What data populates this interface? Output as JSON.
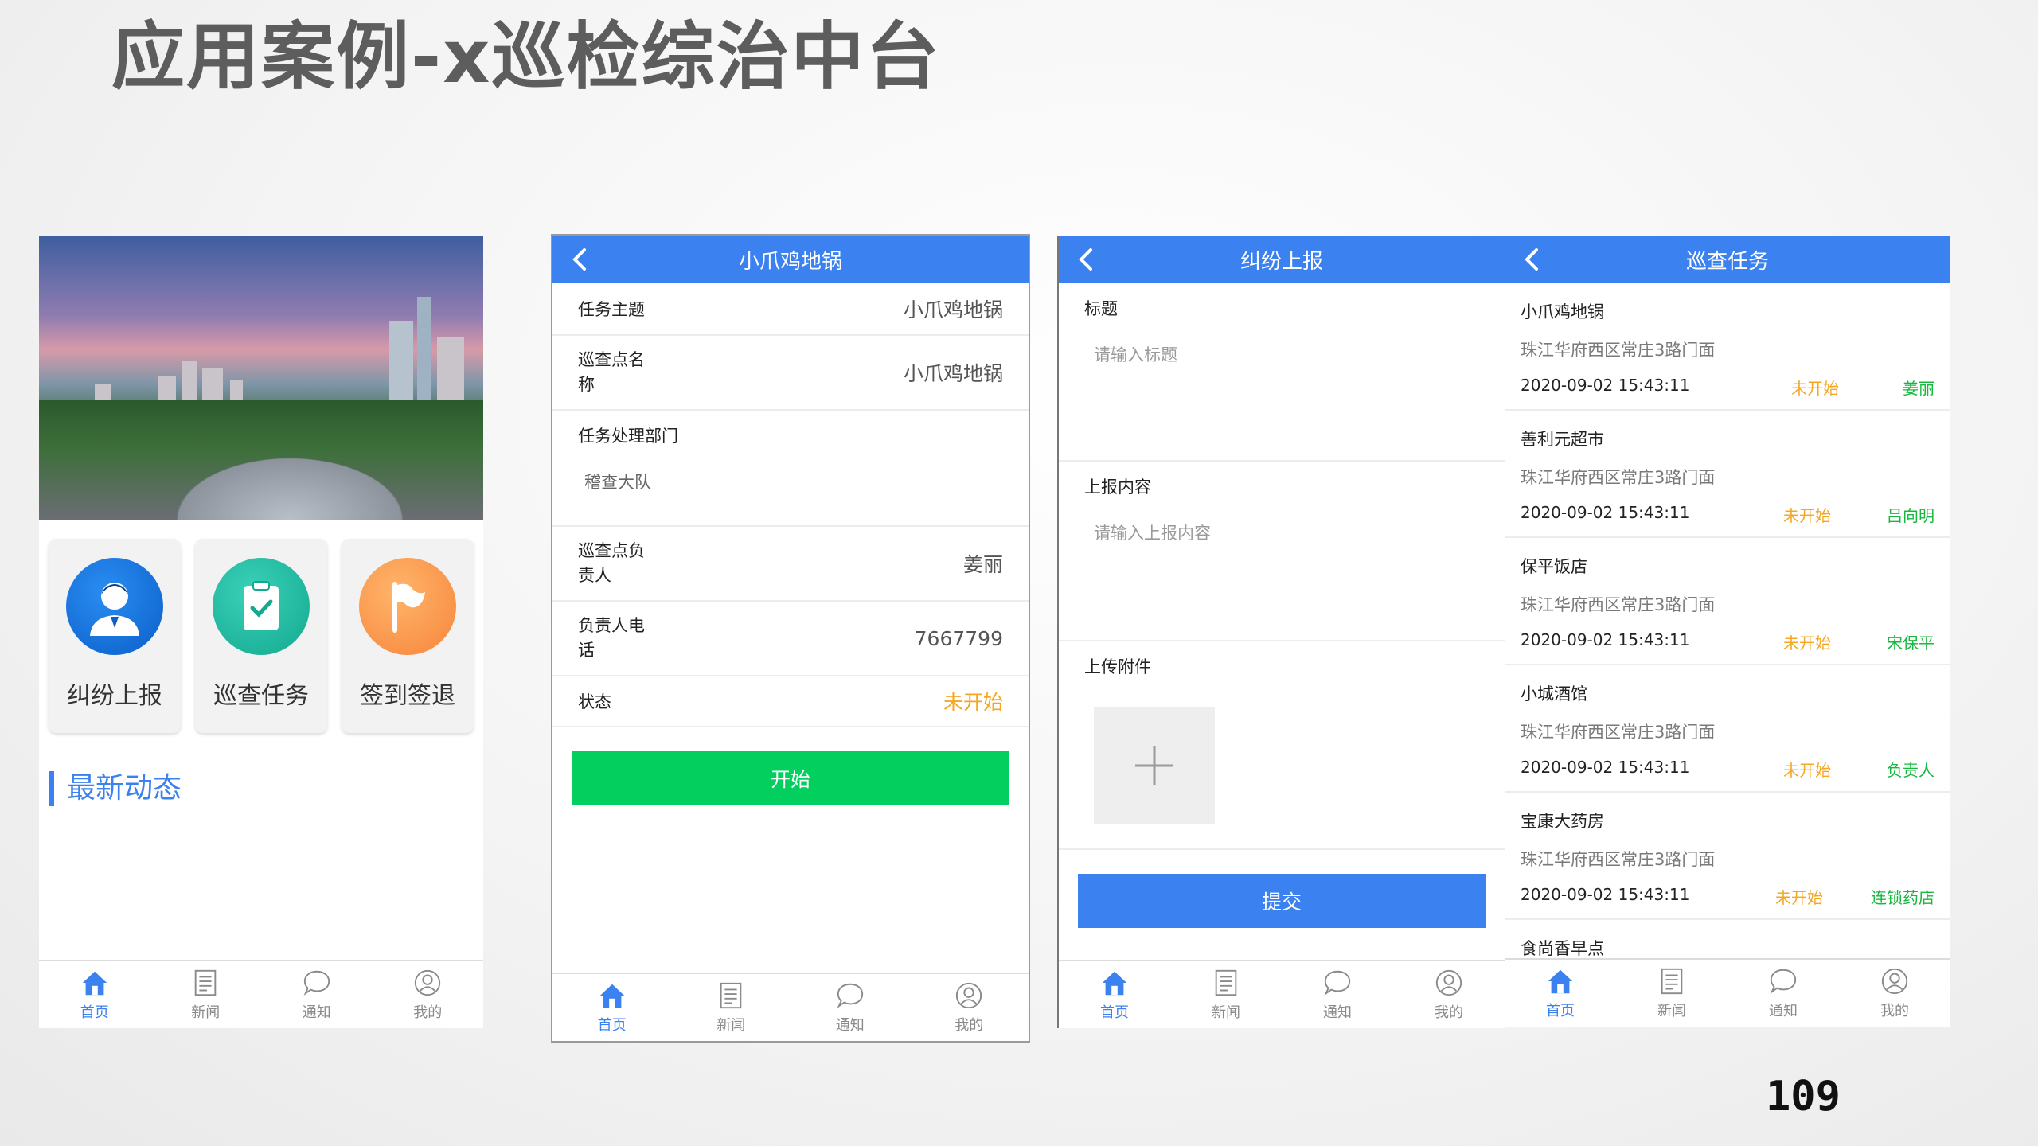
{
  "slide": {
    "title": "应用案例-x巡检综治中台",
    "page_number": "109"
  },
  "tabbar": {
    "home": "首页",
    "news": "新闻",
    "notice": "通知",
    "mine": "我的"
  },
  "colors": {
    "primary": "#3b82f0",
    "start_button": "#03cf5f",
    "status_pending": "#f5a623",
    "owner": "#17b83e"
  },
  "home": {
    "tiles": [
      {
        "label": "纠纷上报",
        "icon": "user-icon"
      },
      {
        "label": "巡查任务",
        "icon": "clipboard-check-icon"
      },
      {
        "label": "签到签退",
        "icon": "flag-icon"
      }
    ],
    "news_title": "最新动态"
  },
  "task_detail": {
    "title": "小爪鸡地锅",
    "rows": {
      "subject_label": "任务主题",
      "subject_value": "小爪鸡地锅",
      "point_label": "巡查点名\n称",
      "point_value": "小爪鸡地锅",
      "dept_label": "任务处理部门",
      "dept_value": "稽查大队",
      "owner_label": "巡查点负\n责人",
      "owner_value": "姜丽",
      "phone_label": "负责人电\n话",
      "phone_value": "7667799",
      "status_label": "状态",
      "status_value": "未开始"
    },
    "start_button": "开始"
  },
  "report": {
    "title": "纠纷上报",
    "title_label": "标题",
    "title_placeholder": "请输入标题",
    "content_label": "上报内容",
    "content_placeholder": "请输入上报内容",
    "attach_label": "上传附件",
    "submit_button": "提交"
  },
  "patrol_list": {
    "title": "巡查任务",
    "items": [
      {
        "name": "小爪鸡地锅",
        "address": "珠江华府西区常庄3路门面",
        "time": "2020-09-02 15:43:11",
        "status": "未开始",
        "owner": "姜丽"
      },
      {
        "name": "善利元超市",
        "address": "珠江华府西区常庄3路门面",
        "time": "2020-09-02 15:43:11",
        "status": "未开始",
        "owner": "吕向明"
      },
      {
        "name": "保平饭店",
        "address": "珠江华府西区常庄3路门面",
        "time": "2020-09-02 15:43:11",
        "status": "未开始",
        "owner": "宋保平"
      },
      {
        "name": "小城酒馆",
        "address": "珠江华府西区常庄3路门面",
        "time": "2020-09-02 15:43:11",
        "status": "未开始",
        "owner": "负责人"
      },
      {
        "name": "宝康大药房",
        "address": "珠江华府西区常庄3路门面",
        "time": "2020-09-02 15:43:11",
        "status": "未开始",
        "owner": "连锁药店"
      }
    ],
    "partial_item_name": "食尚香早点"
  }
}
